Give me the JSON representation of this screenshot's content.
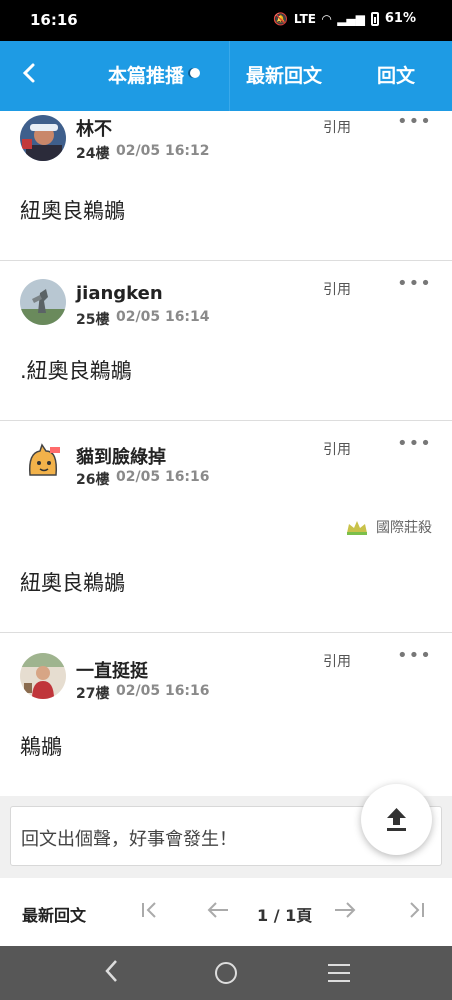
{
  "status_bar": {
    "time": "16:16",
    "battery": "61%",
    "network": "LTE"
  },
  "header": {
    "back_icon": "back-arrow-icon",
    "tabs": [
      {
        "label": "本篇推播"
      },
      {
        "label": "最新回文"
      },
      {
        "label": "回文"
      }
    ]
  },
  "posts": [
    {
      "author": "林不",
      "floor": "24樓",
      "time": "02/05 16:12",
      "quote": "引用",
      "content": "紐奧良鵜鶘",
      "badge": ""
    },
    {
      "author": "jiangken",
      "floor": "25樓",
      "time": "02/05 16:14",
      "quote": "引用",
      "content": ".紐奧良鵜鶘",
      "badge": ""
    },
    {
      "author": "貓到臉綠掉",
      "floor": "26樓",
      "time": "02/05 16:16",
      "quote": "引用",
      "content": "紐奧良鵜鶘",
      "badge": "國際莊殺"
    },
    {
      "author": "一直挺挺",
      "floor": "27樓",
      "time": "02/05 16:16",
      "quote": "引用",
      "content": "鵜鶘",
      "badge": ""
    }
  ],
  "composer": {
    "placeholder": "回文出個聲，好事會發生！"
  },
  "pager": {
    "latest_label": "最新回文",
    "page": "1 / 1頁"
  },
  "colors": {
    "accent": "#1e9be4"
  }
}
